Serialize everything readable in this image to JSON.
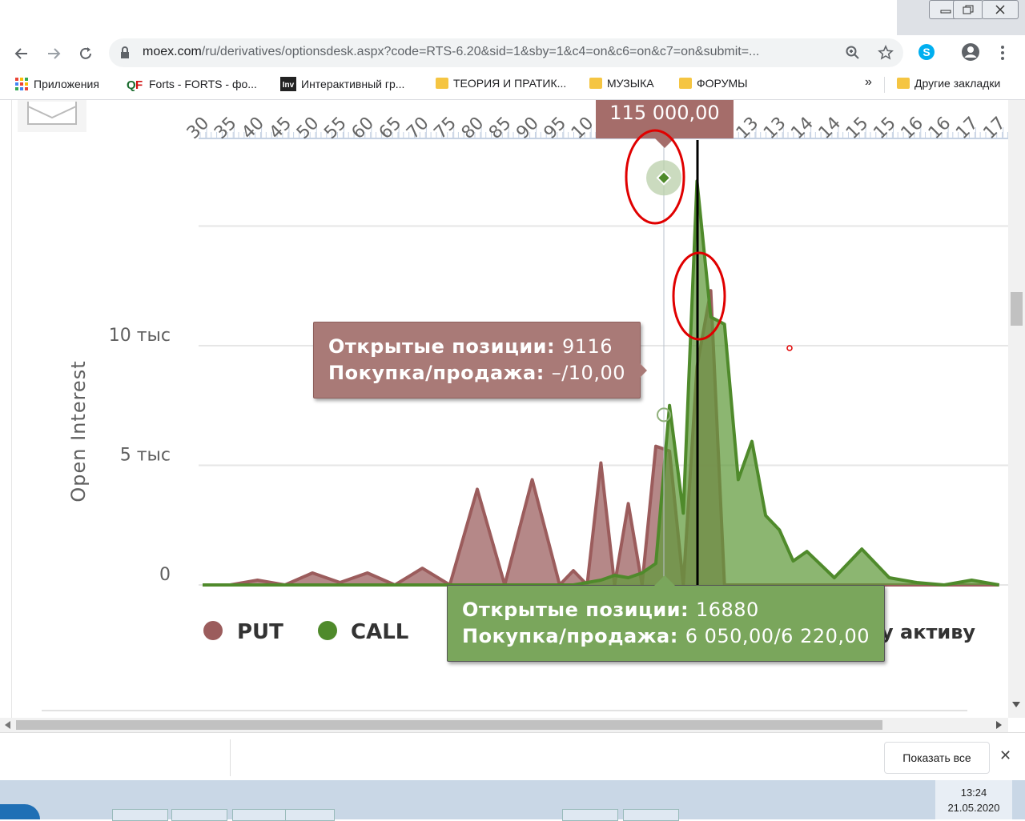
{
  "browser": {
    "url_host": "moex.com",
    "url_rest": "/ru/derivatives/optionsdesk.aspx?code=RTS-6.20&sid=1&sby=1&c4=on&c6=on&c7=on&submit=...",
    "bookmarks": [
      {
        "label": "Приложения",
        "icon": "apps-grid-icon"
      },
      {
        "label": "Forts - FORTS - фо...",
        "icon": "qf-logo-icon"
      },
      {
        "label": "Интерактивный гр...",
        "icon": "inv-logo-icon"
      },
      {
        "label": "ТЕОРИЯ И ПРАТИК...",
        "icon": "folder-icon"
      },
      {
        "label": "МУЗЫКА",
        "icon": "folder-icon"
      },
      {
        "label": "ФОРУМЫ",
        "icon": "folder-icon"
      },
      {
        "label": "Другие закладки",
        "icon": "folder-icon"
      }
    ],
    "overflow_label": "»"
  },
  "chart": {
    "y_axis_title": "Open Interest",
    "y_ticks": [
      "0",
      "5 тыс",
      "10 тыс"
    ],
    "x_ticks": [
      "30",
      "35",
      "40",
      "45",
      "50",
      "55",
      "60",
      "65",
      "70",
      "75",
      "80",
      "85",
      "90",
      "95",
      "10",
      "",
      "",
      "",
      "",
      "",
      "13",
      "13",
      "14",
      "14",
      "15",
      "15",
      "16",
      "16",
      "17",
      "17"
    ],
    "crosshair_label": "115 000,00",
    "partial_label": "у активу",
    "legend": [
      {
        "name": "PUT",
        "color": "#9b5c5c"
      },
      {
        "name": "CALL",
        "color": "#4f8a2b"
      }
    ],
    "tooltip_put": {
      "line1_key": "Открытые позиции:",
      "line1_val": "9116",
      "line2_key": "Покупка/продажа:",
      "line2_val": "–/10,00"
    },
    "tooltip_call": {
      "line1_key": "Открытые позиции:",
      "line1_val": "16880",
      "line2_key": "Покупка/продажа:",
      "line2_val": "6 050,00/6 220,00"
    },
    "colors": {
      "put_fill": "#a87373",
      "put_line": "#9b5c5c",
      "call_fill": "#5f9a3a",
      "call_line": "#4f8a2b",
      "tooltip_put_bg": "#a97a77",
      "tooltip_call_bg": "#7aa65c",
      "crosshair_label_bg": "#a56d6a",
      "annotation": "#e00000"
    }
  },
  "chart_data": {
    "type": "area",
    "x": [
      30,
      35,
      40,
      45,
      50,
      55,
      60,
      65,
      70,
      75,
      80,
      85,
      90,
      95,
      97.5,
      100,
      102.5,
      105,
      107.5,
      110,
      112.5,
      115,
      117.5,
      120,
      122.5,
      125,
      127.5,
      130,
      132.5,
      135,
      137.5,
      140,
      145,
      150,
      155,
      160,
      165,
      170,
      175
    ],
    "ylabel": "Open Interest",
    "series": [
      {
        "name": "PUT",
        "values": [
          0,
          0,
          200,
          0,
          500,
          100,
          500,
          0,
          700,
          0,
          4000,
          0,
          4400,
          0,
          600,
          0,
          5100,
          0,
          3400,
          0,
          5800,
          5600,
          0,
          9116,
          12300,
          0,
          0,
          0,
          0,
          0,
          0,
          0,
          0,
          0,
          0,
          0,
          0,
          0,
          0
        ]
      },
      {
        "name": "CALL",
        "values": [
          0,
          0,
          0,
          0,
          0,
          0,
          0,
          0,
          0,
          0,
          0,
          0,
          0,
          0,
          0,
          100,
          200,
          400,
          300,
          500,
          900,
          7500,
          3000,
          16880,
          11200,
          10900,
          4400,
          6000,
          2900,
          2300,
          1000,
          1400,
          300,
          1500,
          300,
          100,
          0,
          200,
          0
        ]
      }
    ]
  },
  "notification": {
    "show_all_label": "Показать все",
    "close_glyph": "✕"
  },
  "taskbar": {
    "time": "13:24",
    "date": "21.05.2020"
  }
}
